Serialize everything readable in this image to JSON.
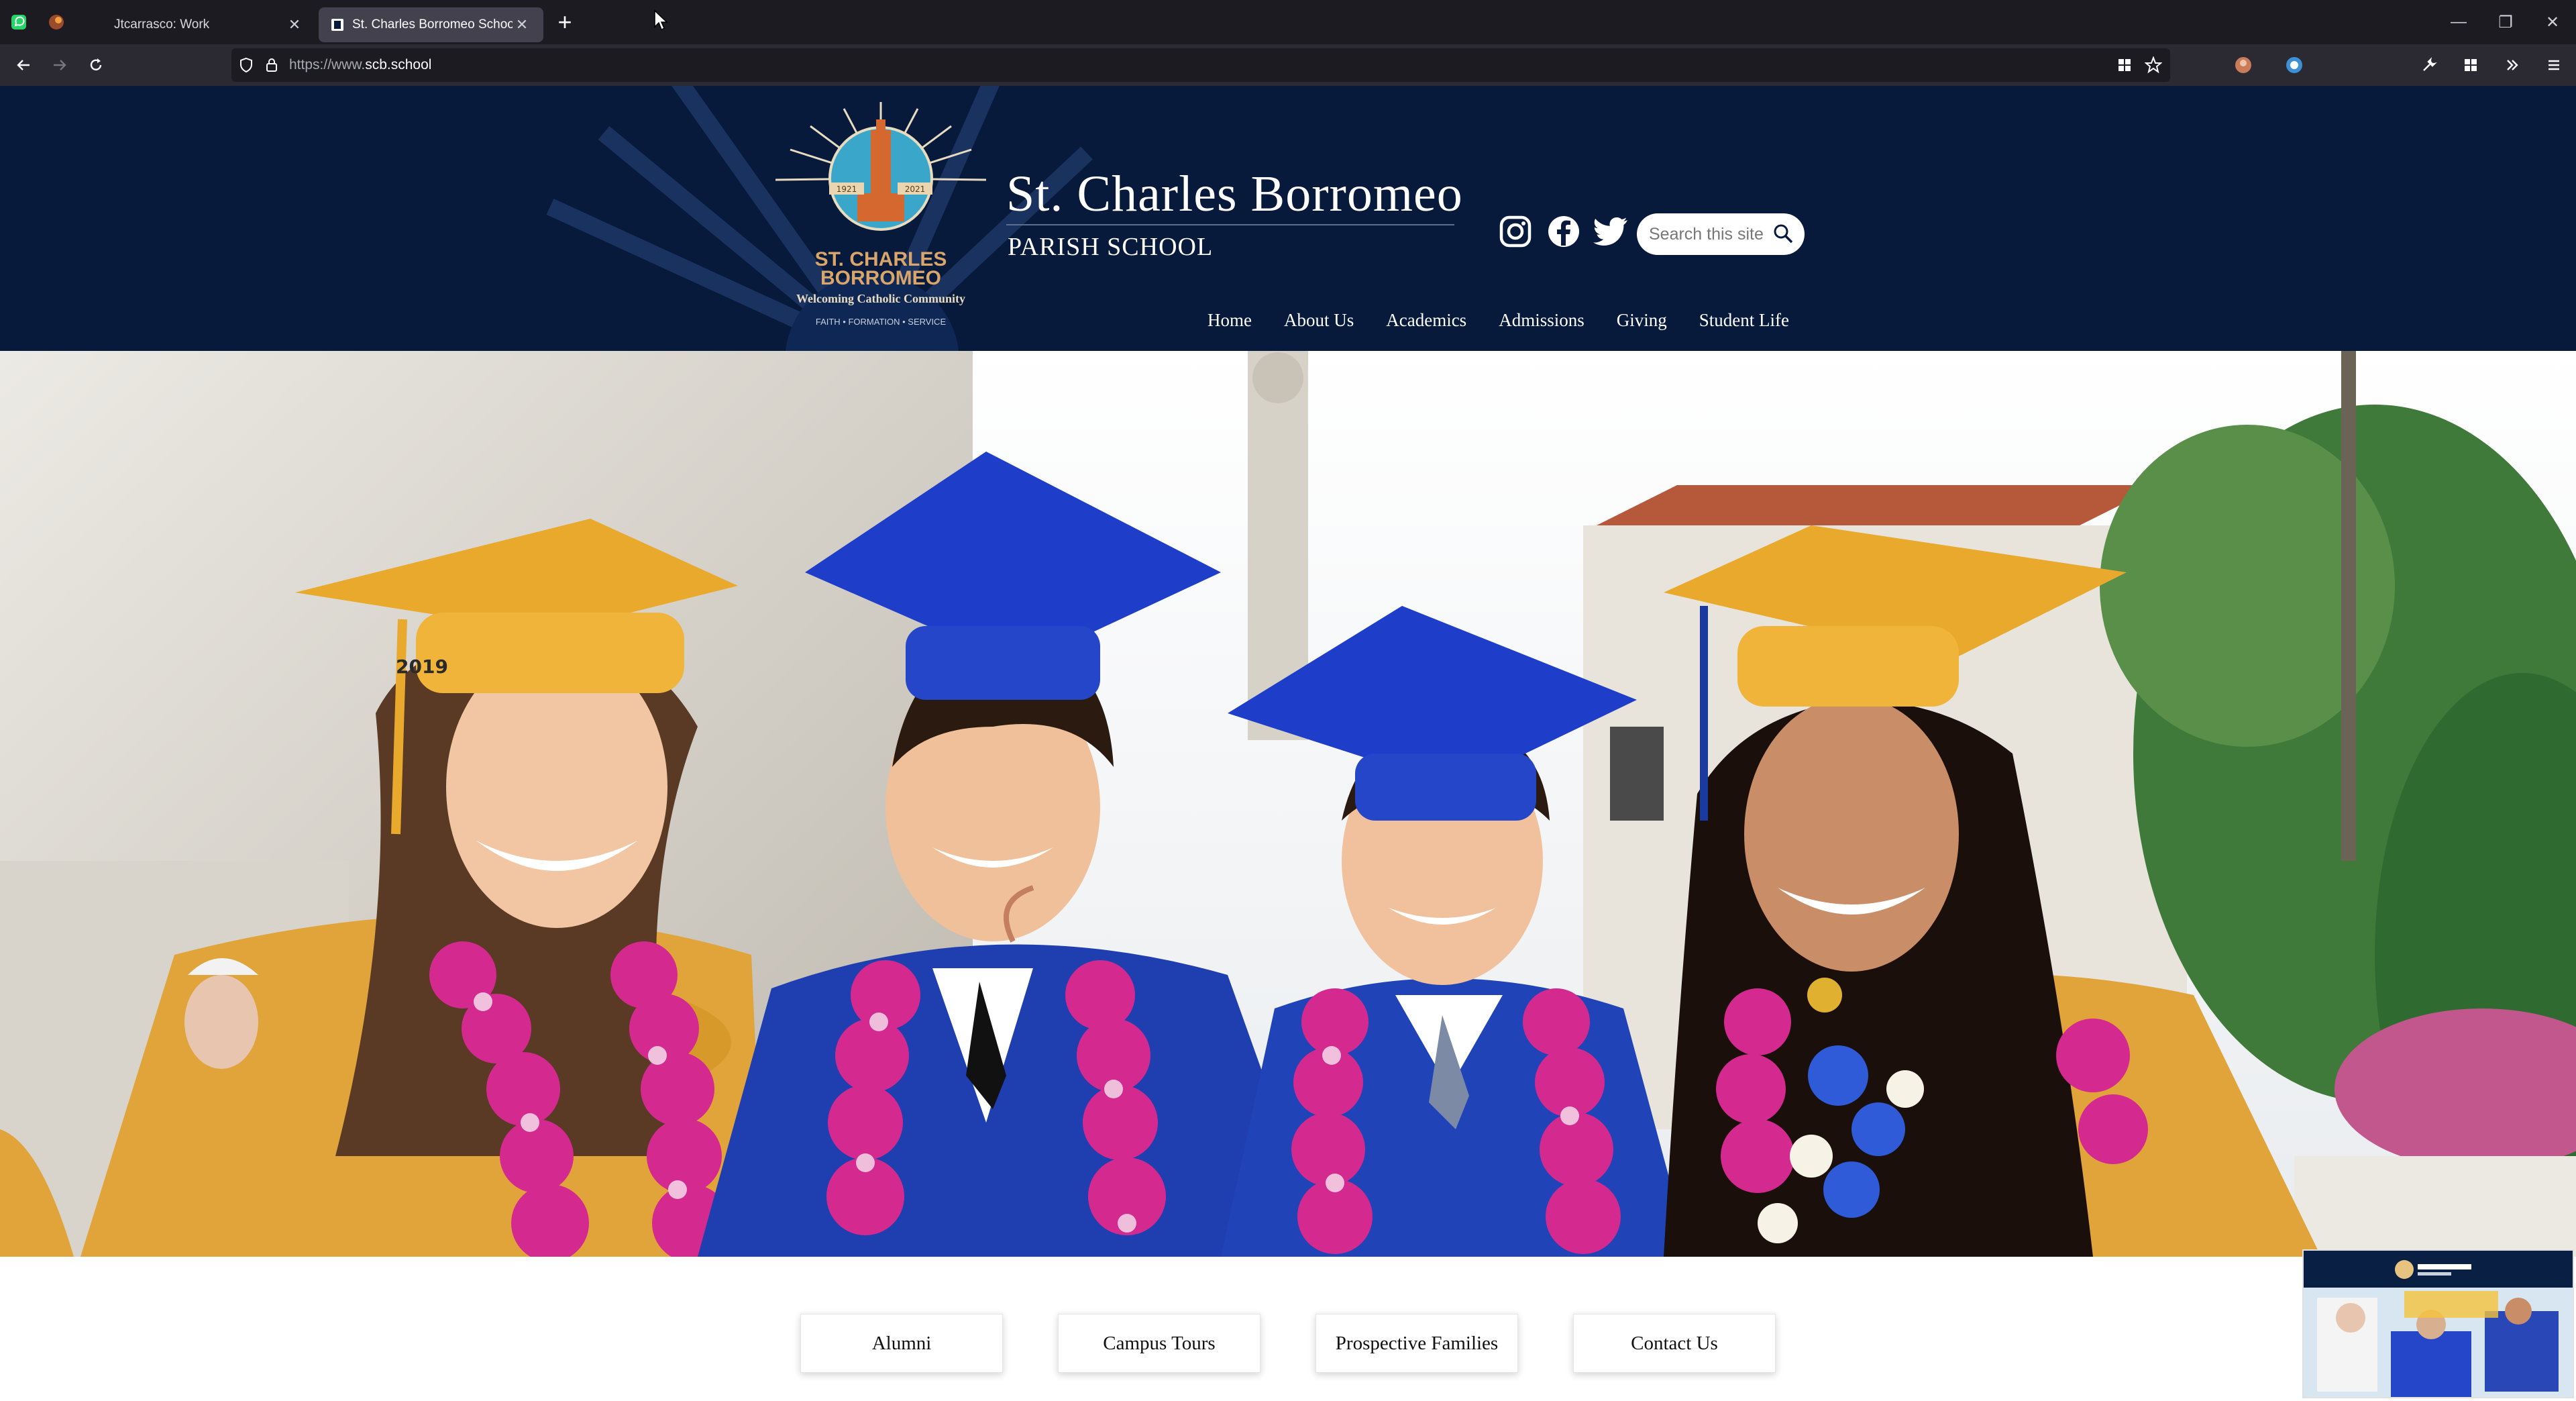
{
  "browser": {
    "tabs": [
      {
        "title": "Jtcarrasco: Work",
        "active": false
      },
      {
        "title": "St. Charles Borromeo School",
        "active": true
      }
    ],
    "url": {
      "prefix": "https://www.",
      "host": "scb.school"
    },
    "pinned_icons": [
      "whatsapp-icon",
      "browser-extension-icon"
    ]
  },
  "site": {
    "title": "St. Charles Borromeo",
    "subtitle": "PARISH SCHOOL",
    "crest": {
      "name_line1": "ST. CHARLES",
      "name_line2": "BORROMEO",
      "tagline": "Welcoming Catholic Community",
      "motto": "FAITH • FORMATION • SERVICE",
      "year_left": "1921",
      "year_right": "2021"
    },
    "social": [
      "instagram-icon",
      "facebook-icon",
      "twitter-icon"
    ],
    "search": {
      "placeholder": "Search this site"
    },
    "nav": [
      "Home",
      "About Us",
      "Academics",
      "Admissions",
      "Giving",
      "Student Life"
    ],
    "hero": {
      "description": "Four graduates in gold and blue caps and gowns wearing flower leis",
      "cap_year": "2019"
    },
    "quick_links": [
      "Alumni",
      "Campus Tours",
      "Prospective Families",
      "Contact Us"
    ]
  },
  "colors": {
    "header_bg": "#071a3b",
    "gold": "#e6a531",
    "blue_gown": "#1f3fb0",
    "lei_pink": "#d42a8f"
  }
}
